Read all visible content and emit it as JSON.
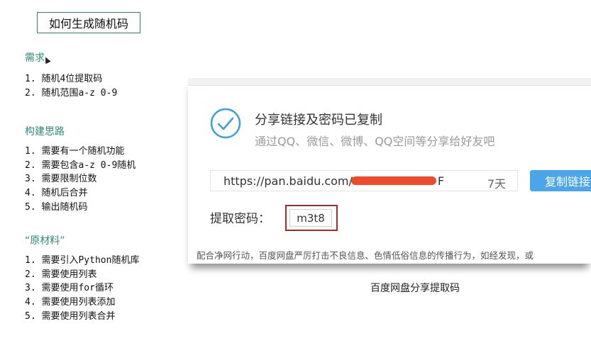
{
  "doc": {
    "title": "如何生成随机码",
    "sections": [
      {
        "heading": "需求",
        "items": [
          "1. 随机4位提取码",
          "2. 随机范围a-z 0-9"
        ]
      },
      {
        "heading": "构建思路",
        "items": [
          "1. 需要有一个随机功能",
          "2. 需要包含a-z 0-9随机",
          "3. 需要限制位数",
          "4. 随机后合并",
          "5. 输出随机码"
        ]
      },
      {
        "heading": "“原材料”",
        "items": [
          "1. 需要引入Python随机库",
          "2. 需要使用列表",
          "3. 需要使用for循环",
          "4. 需要使用列表添加",
          "5. 需要使用列表合并"
        ]
      }
    ]
  },
  "share_dialog": {
    "success_title": "分享链接及密码已复制",
    "success_subtitle": "通过QQ、微信、微博、QQ空间等分享给好友吧",
    "link_prefix": "https://pan.baidu.com/",
    "link_suffix": "F",
    "expiry": "7天",
    "copy_button": "复制链接",
    "code_label": "提取密码：",
    "code_value": "m3t8",
    "notice": "配合净网行动，百度网盘严厉打击不良信息、色情低俗信息的传播行为，如经发现，或"
  },
  "caption": "百度网盘分享提取码",
  "colors": {
    "heading": "#2e8b77",
    "title_border": "#2e8b57",
    "copy_button": "#4aa6e8",
    "code_highlight": "#a52a2a",
    "check_icon": "#3a9ee0",
    "redaction": "#f04a2a"
  }
}
